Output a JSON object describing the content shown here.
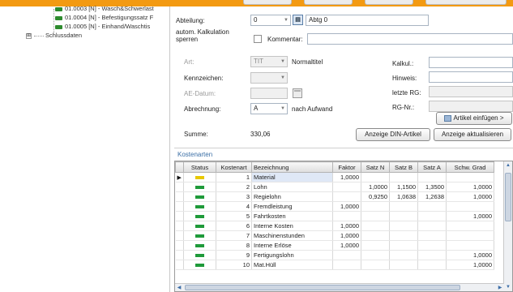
{
  "tree": {
    "items": [
      {
        "label": "01.0003 [N] - Wasch&Schwerlast"
      },
      {
        "label": "01.0004 [N] - Befestigungssatz F"
      },
      {
        "label": "01.0005 [N] - Einhand/Waschtis"
      }
    ],
    "group": {
      "label": "Schlussdaten",
      "expander": "⊞"
    }
  },
  "form": {
    "abteilung": {
      "label": "Abteilung:",
      "value": "0",
      "text": "Abtg 0"
    },
    "autom": {
      "label_line1": "autom. Kalkulation",
      "label_line2": "sperren"
    },
    "kommentar": {
      "label": "Kommentar:",
      "value": ""
    },
    "art": {
      "label": "Art:",
      "value": "TIT",
      "text": "Normaltitel"
    },
    "kennzeichen": {
      "label": "Kennzeichen:",
      "value": ""
    },
    "ae_datum": {
      "label": "AE-Datum:",
      "value": ""
    },
    "abrechnung": {
      "label": "Abrechnung:",
      "value": "A",
      "text": "nach Aufwand"
    },
    "kalkul": {
      "label": "Kalkul.:",
      "value": ""
    },
    "hinweis": {
      "label": "Hinweis:",
      "value": ""
    },
    "letzte_rg": {
      "label": "letzte RG:",
      "value": ""
    },
    "rg_nr": {
      "label": "RG-Nr.:",
      "value": ""
    },
    "artikel_button": "Artikel einfügen >",
    "summe": {
      "label": "Summe:",
      "value": "330,06"
    },
    "anzeige_din_button": "Anzeige DIN-Artikel",
    "anzeige_akt_button": "Anzeige aktualisieren"
  },
  "kostenarten": {
    "title": "Kostenarten",
    "columns": [
      "Status",
      "Kostenart",
      "Bezeichnung",
      "Faktor",
      "Satz N",
      "Satz B",
      "Satz A",
      "Schw. Grad"
    ],
    "rows": [
      {
        "status": "yellow",
        "kostenart": "1",
        "bezeichnung": "Material",
        "faktor": "1,0000",
        "satz_n": "",
        "satz_b": "",
        "satz_a": "",
        "schw": ""
      },
      {
        "status": "green",
        "kostenart": "2",
        "bezeichnung": "Lohn",
        "faktor": "",
        "satz_n": "1,0000",
        "satz_b": "1,1500",
        "satz_a": "1,3500",
        "schw": "1,0000"
      },
      {
        "status": "green",
        "kostenart": "3",
        "bezeichnung": "Regielohn",
        "faktor": "",
        "satz_n": "0,9250",
        "satz_b": "1,0638",
        "satz_a": "1,2638",
        "schw": "1,0000"
      },
      {
        "status": "green",
        "kostenart": "4",
        "bezeichnung": "Fremdleistung",
        "faktor": "1,0000",
        "satz_n": "",
        "satz_b": "",
        "satz_a": "",
        "schw": ""
      },
      {
        "status": "green",
        "kostenart": "5",
        "bezeichnung": "Fahrtkosten",
        "faktor": "",
        "satz_n": "",
        "satz_b": "",
        "satz_a": "",
        "schw": "1,0000"
      },
      {
        "status": "green",
        "kostenart": "6",
        "bezeichnung": "Interne Kosten",
        "faktor": "1,0000",
        "satz_n": "",
        "satz_b": "",
        "satz_a": "",
        "schw": ""
      },
      {
        "status": "green",
        "kostenart": "7",
        "bezeichnung": "Maschinenstunden",
        "faktor": "1,0000",
        "satz_n": "",
        "satz_b": "",
        "satz_a": "",
        "schw": ""
      },
      {
        "status": "green",
        "kostenart": "8",
        "bezeichnung": "Interne Erlöse",
        "faktor": "1,0000",
        "satz_n": "",
        "satz_b": "",
        "satz_a": "",
        "schw": ""
      },
      {
        "status": "green",
        "kostenart": "9",
        "bezeichnung": "Fertigungslohn",
        "faktor": "",
        "satz_n": "",
        "satz_b": "",
        "satz_a": "",
        "schw": "1,0000"
      },
      {
        "status": "green",
        "kostenart": "10",
        "bezeichnung": "Mat.Hüll",
        "faktor": "",
        "satz_n": "",
        "satz_b": "",
        "satz_a": "",
        "schw": "1,0000"
      }
    ]
  },
  "colors": {
    "accent": "#f39a12",
    "status_green": "#1f9a3a",
    "status_yellow": "#e8c800"
  }
}
